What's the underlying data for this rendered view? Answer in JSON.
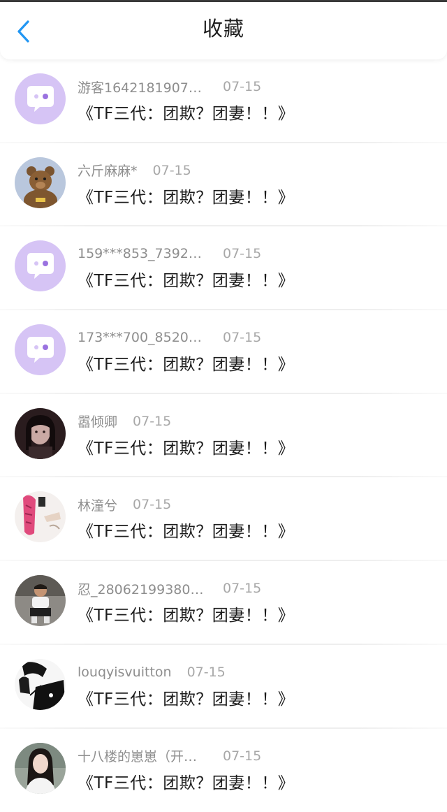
{
  "header": {
    "title": "收藏",
    "back_icon": "chevron-left-icon",
    "accent_color": "#2196f3"
  },
  "favorites": [
    {
      "user": "游客1642181907…",
      "date": "07-15",
      "title": "《TF三代：团欺？团妻！！》",
      "avatar": "default-chat-avatar"
    },
    {
      "user": "六斤麻麻*",
      "date": "07-15",
      "title": "《TF三代：团欺？团妻！！》",
      "avatar": "teddy-bear-avatar"
    },
    {
      "user": "159***853_73927…",
      "date": "07-15",
      "title": "《TF三代：团欺？团妻！！》",
      "avatar": "default-chat-avatar"
    },
    {
      "user": "173***700_85202…",
      "date": "07-15",
      "title": "《TF三代：团欺？团妻！！》",
      "avatar": "default-chat-avatar"
    },
    {
      "user": "嚣倾卿",
      "date": "07-15",
      "title": "《TF三代：团欺？团妻！！》",
      "avatar": "girl-dark-photo-avatar"
    },
    {
      "user": "林潼兮",
      "date": "07-15",
      "title": "《TF三代：团欺？团妻！！》",
      "avatar": "pink-hair-photo-avatar"
    },
    {
      "user": "忍_28062199380…",
      "date": "07-15",
      "title": "《TF三代：团欺？团妻！！》",
      "avatar": "child-photo-avatar"
    },
    {
      "user": "louqyisvuitton",
      "date": "07-15",
      "title": "《TF三代：团欺？团妻！！》",
      "avatar": "sketch-portrait-avatar"
    },
    {
      "user": "十八楼的崽崽（开…",
      "date": "07-15",
      "title": "《TF三代：团欺？团妻！！》",
      "avatar": "woman-portrait-avatar"
    }
  ]
}
